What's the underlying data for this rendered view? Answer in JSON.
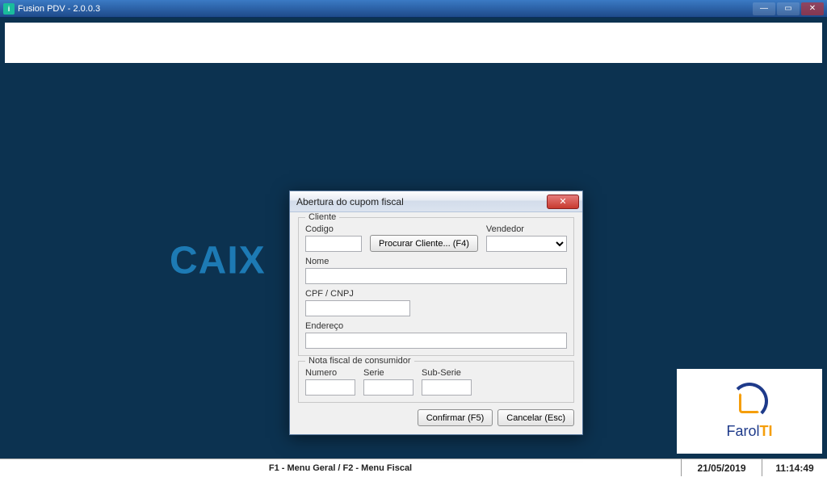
{
  "os": {
    "title": "Fusion PDV - 2.0.0.3",
    "icon_letter": "i"
  },
  "background": {
    "caixa_text": "CAIX",
    "logo_brand_a": "Farol",
    "logo_brand_b": "TI"
  },
  "statusbar": {
    "menus": "F1 - Menu Geral   /   F2 - Menu Fiscal",
    "date": "21/05/2019",
    "time": "11:14:49"
  },
  "dialog": {
    "title": "Abertura do cupom fiscal",
    "group_cliente": "Cliente",
    "label_codigo": "Codigo",
    "codigo_value": "",
    "btn_procurar": "Procurar Cliente... (F4)",
    "label_vendedor": "Vendedor",
    "vendedor_value": "",
    "label_nome": "Nome",
    "nome_value": "",
    "label_cpf": "CPF / CNPJ",
    "cpf_value": "",
    "label_endereco": "Endereço",
    "endereco_value": "",
    "group_nota": "Nota fiscal de consumidor",
    "label_numero": "Numero",
    "numero_value": "",
    "label_serie": "Serie",
    "serie_value": "",
    "label_subserie": "Sub-Serie",
    "subserie_value": "",
    "btn_confirmar": "Confirmar (F5)",
    "btn_cancelar": "Cancelar (Esc)"
  }
}
